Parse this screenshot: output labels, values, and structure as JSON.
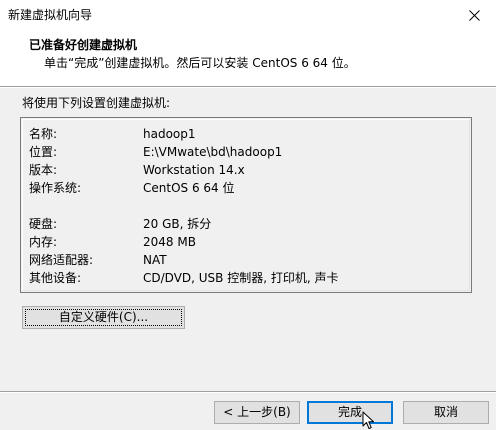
{
  "window": {
    "title": "新建虚拟机向导",
    "close_glyph": "✕"
  },
  "header": {
    "title": "已准备好创建虚拟机",
    "subtitle": "单击“完成”创建虚拟机。然后可以安装 CentOS 6 64 位。"
  },
  "intro": "将使用下列设置创建虚拟机:",
  "summary": {
    "rows": [
      {
        "label": "名称:",
        "value": "hadoop1"
      },
      {
        "label": "位置:",
        "value": "E:\\VMwate\\bd\\hadoop1"
      },
      {
        "label": "版本:",
        "value": "Workstation 14.x"
      },
      {
        "label": "操作系统:",
        "value": "CentOS 6 64 位"
      },
      {
        "label": "硬盘:",
        "value": "20 GB, 拆分"
      },
      {
        "label": "内存:",
        "value": "2048 MB"
      },
      {
        "label": "网络适配器:",
        "value": "NAT"
      },
      {
        "label": "其他设备:",
        "value": "CD/DVD, USB 控制器, 打印机, 声卡"
      }
    ]
  },
  "buttons": {
    "customize": "自定义硬件(C)...",
    "back": "< 上一步(B)",
    "finish": "完成",
    "cancel": "取消"
  },
  "colors": {
    "default_button_border": "#0078d7",
    "dialog_background": "#f0f0f0",
    "header_background": "#ffffff"
  }
}
